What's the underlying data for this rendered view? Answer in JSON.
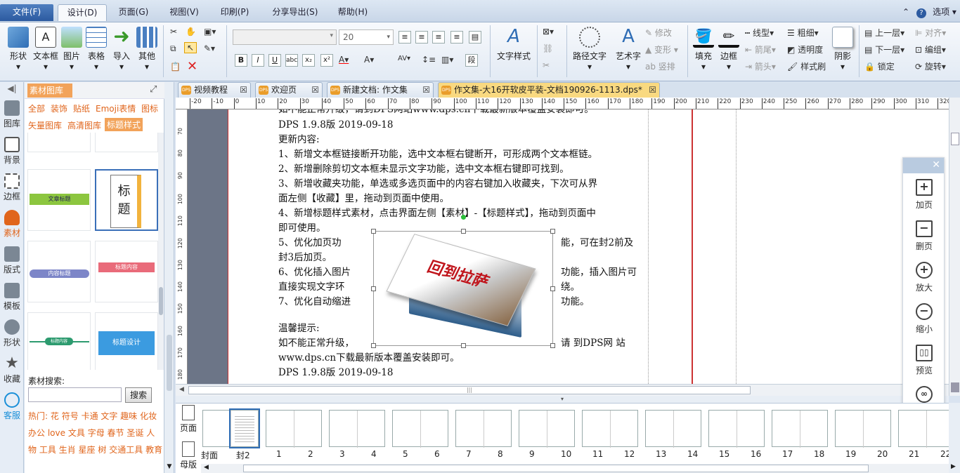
{
  "menu": {
    "file": "文件(F)",
    "design": "设计(D)",
    "page": "页面(G)",
    "view": "视图(V)",
    "print": "印刷(P)",
    "share": "分享导出(S)",
    "help": "帮助(H)",
    "options": "选项"
  },
  "ribbon": {
    "shape": "形状",
    "textbox": "文本框",
    "image": "图片",
    "table": "表格",
    "import": "导入",
    "other": "其他",
    "font_size": "20",
    "text_style": "文字样式",
    "path_text": "路径文字",
    "art_text": "艺术字",
    "modify": "修改",
    "transform": "变形",
    "vertical": "竖排",
    "fill": "填充",
    "border": "边框",
    "line_type": "线型",
    "thickness": "粗细",
    "arrow_tail": "箭尾",
    "transparency": "透明度",
    "arrow_head": "箭头",
    "style_brush": "样式刷",
    "shadow": "阴影",
    "layer_up": "上一层",
    "align": "对齐",
    "layer_down": "下一层",
    "group": "编组",
    "lock": "锁定",
    "rotate": "旋转"
  },
  "sidebar": {
    "items": [
      "图库",
      "背景",
      "边框",
      "素材",
      "版式",
      "模板",
      "形状",
      "收藏",
      "客服"
    ]
  },
  "panel": {
    "title": "素材图库",
    "tags": [
      "全部",
      "装饰",
      "贴纸",
      "Emoji表情",
      "图标",
      "矢量图库",
      "高清图库",
      "标题样式"
    ],
    "cards": [
      "文章标题",
      "标",
      "题",
      "内容标题",
      "标题内容",
      "标题内容",
      "标题设计"
    ],
    "search_label": "素材搜索:",
    "search_button": "搜索",
    "hot_label": "热门:",
    "hot": [
      "花",
      "符号",
      "卡通",
      "文字",
      "趣味",
      "化妆",
      "办公",
      "love",
      "文具",
      "字母",
      "春节",
      "圣诞",
      "人物",
      "工具",
      "生肖",
      "星座",
      "树",
      "交通工具",
      "教育"
    ]
  },
  "tabs": [
    {
      "label": "视频教程"
    },
    {
      "label": "欢迎页"
    },
    {
      "label": "新建文档: 作文集"
    },
    {
      "label": "作文集-大16开软皮平装-文档190926-1113.dps*"
    }
  ],
  "ruler_labels": [
    "-20",
    "-10",
    "0",
    "10",
    "20",
    "30",
    "40",
    "50",
    "60",
    "70",
    "80",
    "90",
    "100",
    "110",
    "120",
    "130",
    "140",
    "150",
    "160",
    "170",
    "180",
    "190",
    "200",
    "210",
    "220",
    "230",
    "240",
    "250",
    "260",
    "270",
    "280",
    "290",
    "300",
    "310",
    "320"
  ],
  "vruler_labels": [
    "70",
    "80",
    "90",
    "100",
    "110",
    "120",
    "130",
    "140",
    "150",
    "160",
    "170",
    "180"
  ],
  "document": {
    "line0": "如不能正常升级，请到DPS网站www.dps.cn下载最新版本覆盖安装即可。",
    "line1": "DPS 1.9.8版 2019-09-18",
    "line2": "更新内容:",
    "line3": "1、新增文本框链接断开功能，选中文本框右键断开，可形成两个文本框链。",
    "line4": "2、新增删除剪切文本框未显示文字功能，选中文本框右键即可找到。",
    "line5": "3、新增收藏夹功能，单选或多选页面中的内容右键加入收藏夹，下次可从界",
    "line6": "面左侧【收藏】里，拖动到页面中使用。",
    "line7": "4、新增标题样式素材，点击界面左侧【素材】-【标题样式】，拖动到页面中",
    "line8": "即可使用。",
    "line9a": "5、优化加页功",
    "line9b": "能，可在封2前及",
    "line10": "封3后加页。",
    "line11a": "6、优化插入图片",
    "line11b": "功能，插入图片可",
    "line12a": "直接实现文字环",
    "line12b": "绕。",
    "line13a": "7、优化自动缩进",
    "line13b": "功能。",
    "line14": "温馨提示:",
    "line15a": "如不能正常升级，",
    "line15b": "请 到DPS网 站",
    "line16": "www.dps.cn下载最新版本覆盖安装即可。",
    "line17": "DPS 1.9.8版 2019-09-18",
    "image_text": "回到拉萨"
  },
  "float_panel": {
    "add": "加页",
    "delete": "删页",
    "zoom_in": "放大",
    "zoom_out": "缩小",
    "preview": "预览",
    "share": "分享"
  },
  "pages": {
    "page_btn": "页面",
    "master_btn": "母版",
    "labels": [
      "封面",
      "封2",
      "1",
      "2",
      "3",
      "4",
      "5",
      "6",
      "7",
      "8",
      "9",
      "10",
      "11",
      "12",
      "13",
      "14",
      "15",
      "16",
      "17",
      "18",
      "19",
      "20",
      "21",
      "22"
    ]
  }
}
